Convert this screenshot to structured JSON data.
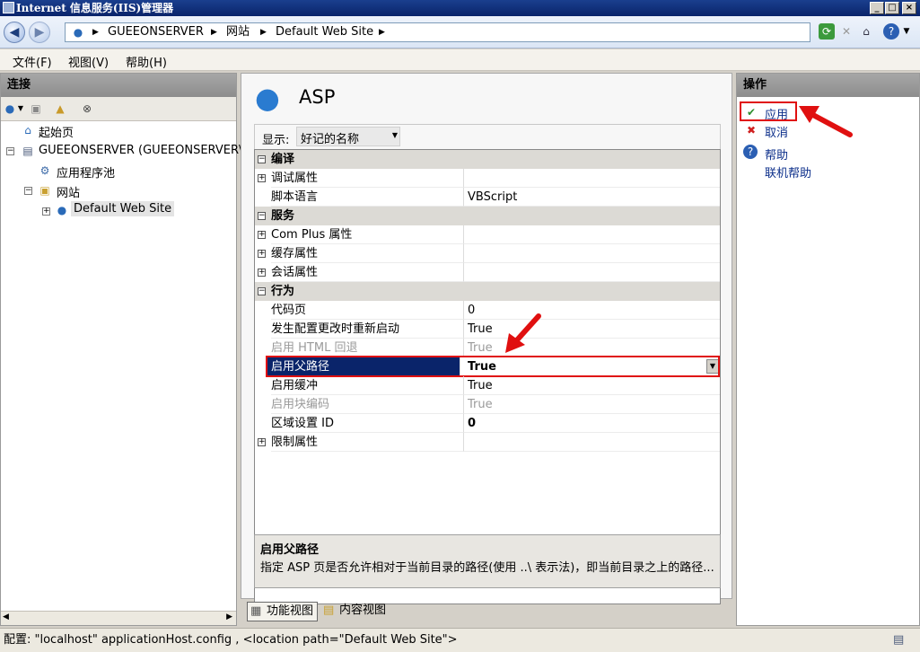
{
  "window": {
    "title": "Internet 信息服务(IIS)管理器",
    "controls": [
      "_",
      "□",
      "×"
    ]
  },
  "breadcrumb": [
    "GUEEONSERVER",
    "网站",
    "Default Web Site"
  ],
  "menu": [
    "文件(F)",
    "视图(V)",
    "帮助(H)"
  ],
  "connections": {
    "title": "连接",
    "tree": {
      "start_page": "起始页",
      "server": "GUEEONSERVER (GUEEONSERVER\\",
      "app_pools": "应用程序池",
      "sites": "网站",
      "default_site": "Default Web Site"
    }
  },
  "feature": {
    "title": "ASP",
    "display_label": "显示:",
    "display_value": "好记的名称",
    "rows": [
      {
        "kind": "section",
        "name": "编译"
      },
      {
        "kind": "expand",
        "name": "调试属性",
        "value": ""
      },
      {
        "kind": "item",
        "name": "脚本语言",
        "value": "VBScript"
      },
      {
        "kind": "section",
        "name": "服务"
      },
      {
        "kind": "expand",
        "name": "Com Plus 属性",
        "value": ""
      },
      {
        "kind": "expand",
        "name": "缓存属性",
        "value": ""
      },
      {
        "kind": "expand",
        "name": "会话属性",
        "value": ""
      },
      {
        "kind": "section",
        "name": "行为"
      },
      {
        "kind": "item",
        "name": "代码页",
        "value": "0"
      },
      {
        "kind": "item",
        "name": "发生配置更改时重新启动",
        "value": "True"
      },
      {
        "kind": "disabled",
        "name": "启用 HTML 回退",
        "value": "True"
      },
      {
        "kind": "selected",
        "name": "启用父路径",
        "value": "True"
      },
      {
        "kind": "item",
        "name": "启用缓冲",
        "value": "True"
      },
      {
        "kind": "disabled",
        "name": "启用块编码",
        "value": "True"
      },
      {
        "kind": "bold",
        "name": "区域设置 ID",
        "value": "0"
      },
      {
        "kind": "expand",
        "name": "限制属性",
        "value": ""
      }
    ],
    "description_title": "启用父路径",
    "description_text": "指定 ASP 页是否允许相对于当前目录的路径(使用 ..\\ 表示法)，即当前目录之上的路径..."
  },
  "view_tabs": [
    "功能视图",
    "内容视图"
  ],
  "actions": {
    "title": "操作",
    "apply": "应用",
    "cancel": "取消",
    "help": "帮助",
    "online_help": "联机帮助"
  },
  "status": "配置: \"localhost\" applicationHost.config , <location path=\"Default Web Site\">",
  "colors": {
    "selection": "#0a246a",
    "highlight_box": "#e01010",
    "link": "#0b2e8a"
  }
}
